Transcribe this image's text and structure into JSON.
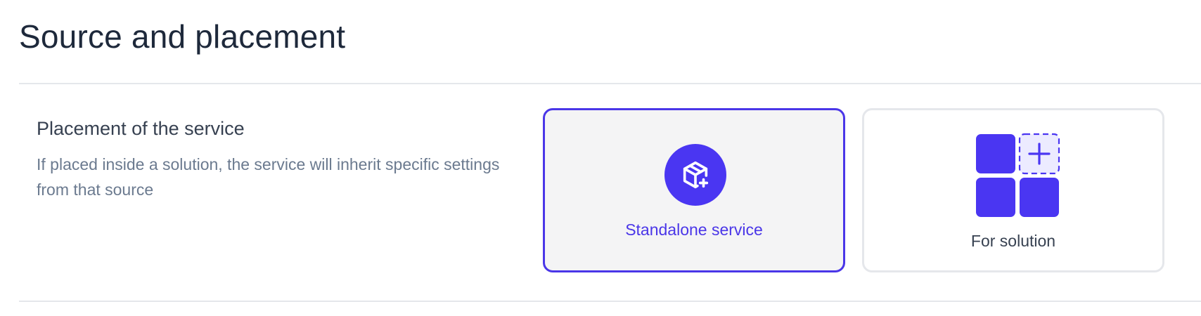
{
  "page": {
    "title": "Source and placement"
  },
  "placement": {
    "heading": "Placement of the service",
    "description": "If placed inside a solution, the service will inherit specific settings from that source"
  },
  "options": [
    {
      "label": "Standalone service",
      "icon": "package-plus-icon",
      "selected": true
    },
    {
      "label": "For solution",
      "icon": "grid-add-icon",
      "selected": false
    }
  ],
  "colors": {
    "accent": "#4a36e8",
    "selected_bg": "#f4f4f5",
    "border": "#e5e7eb",
    "heading": "#1e293b",
    "muted_text": "#6b7a8f"
  }
}
